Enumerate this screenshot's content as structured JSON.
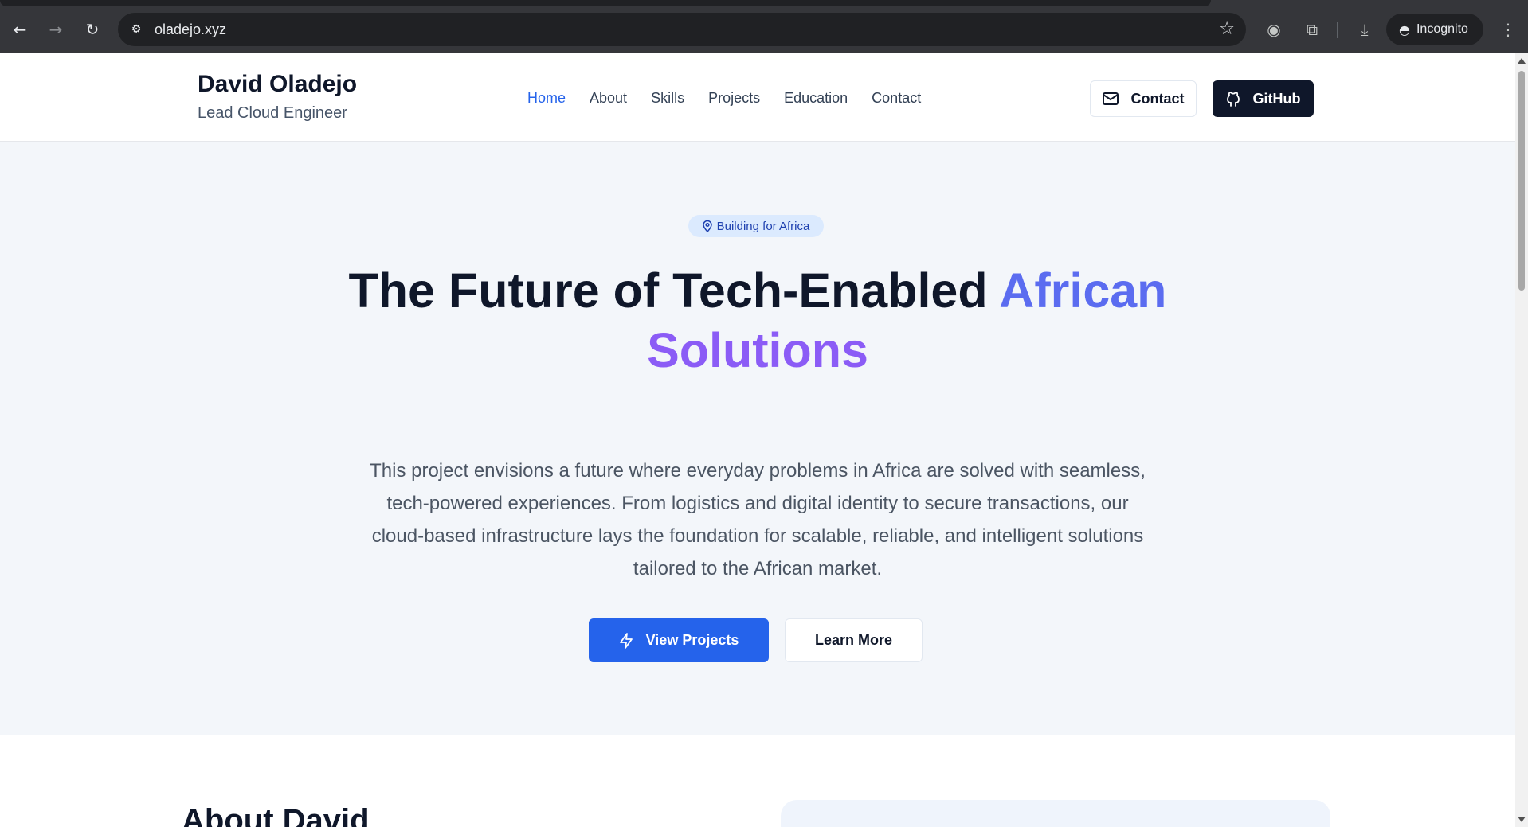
{
  "browser": {
    "url": "oladejo.xyz",
    "incognito_label": "Incognito",
    "icons": [
      "back-arrow-icon",
      "forward-arrow-icon",
      "reload-icon",
      "site-settings-icon",
      "bookmark-star-icon",
      "camera-icon",
      "extensions-icon",
      "download-icon",
      "incognito-icon",
      "more-menu-icon"
    ]
  },
  "header": {
    "name": "David Oladejo",
    "role": "Lead Cloud Engineer",
    "nav": [
      {
        "label": "Home",
        "active": true
      },
      {
        "label": "About"
      },
      {
        "label": "Skills"
      },
      {
        "label": "Projects"
      },
      {
        "label": "Education"
      },
      {
        "label": "Contact"
      }
    ],
    "contact_button": "Contact",
    "github_button": "GitHub"
  },
  "hero": {
    "badge": "Building for Africa",
    "title_main": "The Future of Tech-Enabled ",
    "title_accent1": "African",
    "title_accent2": "Solutions",
    "description": "This project envisions a future where everyday problems in Africa are solved with seamless, tech-powered experiences. From logistics and digital identity to secure transactions, our cloud-based infrastructure lays the foundation for scalable, reliable, and intelligent solutions tailored to the African market.",
    "primary_button": "View Projects",
    "secondary_button": "Learn More"
  },
  "about": {
    "title": "About David"
  },
  "colors": {
    "accent_blue": "#2563eb",
    "title_gradient_start": "#5b6cf0",
    "title_gradient_end": "#8b5cf6",
    "dark": "#0f172a"
  }
}
